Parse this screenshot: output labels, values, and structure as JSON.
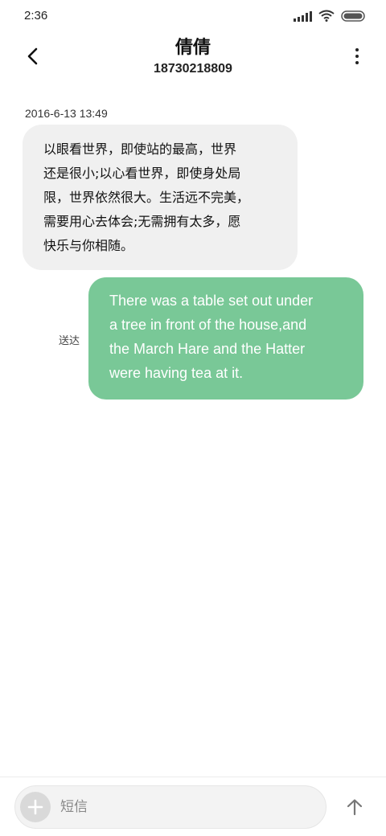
{
  "status_bar": {
    "time": "2:36",
    "icons": [
      "signal-icon",
      "wifi-icon",
      "battery-icon"
    ]
  },
  "header": {
    "contact_name": "倩倩",
    "contact_number": "18730218809",
    "back_icon": "chevron-left-icon",
    "more_icon": "more-vertical-icon"
  },
  "conversation": {
    "timestamp": "2016-6-13 13:49",
    "incoming_message": {
      "lines": [
        "以眼看世界，即使站的最高，世界",
        "还是很小;以心看世界，即使身处局",
        "限，世界依然很大。生活远不完美，",
        "需要用心去体会;无需拥有太多，愿",
        "快乐与你相随。"
      ]
    },
    "outgoing_message": {
      "lines": [
        "There was a table set out under",
        "a tree in front of the house,and",
        "the March Hare and the Hatter",
        "were having tea at it."
      ],
      "status": "送达"
    }
  },
  "composer": {
    "placeholder": "短信",
    "value": "",
    "add_icon": "plus-icon",
    "send_icon": "arrow-up-icon"
  },
  "colors": {
    "outgoing_bubble": "#79c897",
    "incoming_bubble": "#f0f0f0"
  }
}
